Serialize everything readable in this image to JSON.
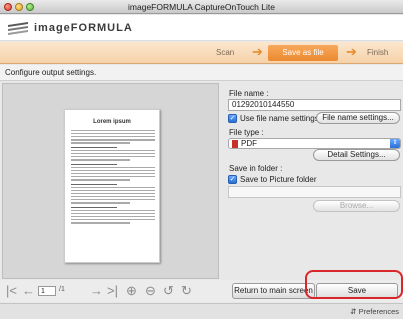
{
  "window": {
    "title": "imageFORMULA CaptureOnTouch Lite"
  },
  "brand": {
    "name": "imageFORMULA"
  },
  "steps": {
    "scan": "Scan",
    "save": "Save as file",
    "finish": "Finish"
  },
  "instructions": "Configure output settings.",
  "preview": {
    "doc_title": "Lorem ipsum",
    "page_current": "1",
    "page_total": "/1"
  },
  "settings": {
    "file_name_label": "File name :",
    "file_name_value": "01292010144550",
    "use_file_name_settings": "Use file name settings",
    "file_name_settings_button": "File name settings...",
    "file_type_label": "File type :",
    "file_type_value": "PDF",
    "detail_settings_button": "Detail Settings...",
    "save_in_folder_label": "Save in folder :",
    "save_to_picture_folder": "Save to Picture folder",
    "browse_button": "Browse..."
  },
  "actions": {
    "return": "Return to main screen",
    "save": "Save"
  },
  "status": {
    "preferences": "Preferences"
  },
  "colors": {
    "accent": "#ec8a2f",
    "highlight": "#d9262a"
  },
  "icons": [
    "first-page-icon",
    "prev-page-icon",
    "next-page-icon",
    "last-page-icon",
    "zoom-in-icon",
    "zoom-out-icon",
    "rotate-left-icon",
    "rotate-right-icon",
    "preferences-icon"
  ]
}
